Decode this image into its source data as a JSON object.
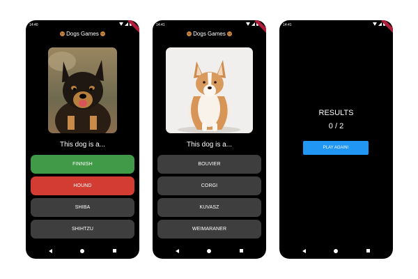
{
  "screens": [
    {
      "status_time": "14:40",
      "app_title": "Dogs Games",
      "question": "This dog is a...",
      "answers": [
        {
          "label": "FINNISH",
          "state": "correct"
        },
        {
          "label": "HOUND",
          "state": "wrong"
        },
        {
          "label": "SHIBA",
          "state": "default"
        },
        {
          "label": "SHIHTZU",
          "state": "default"
        }
      ],
      "photo": "black-and-tan finnish lapphund dog"
    },
    {
      "status_time": "14:41",
      "app_title": "Dogs Games",
      "question": "This dog is a...",
      "answers": [
        {
          "label": "BOUVIER",
          "state": "default"
        },
        {
          "label": "CORGI",
          "state": "default"
        },
        {
          "label": "KUVASZ",
          "state": "default"
        },
        {
          "label": "WEIMARANER",
          "state": "default"
        }
      ],
      "photo": "sitting corgi on white background"
    },
    {
      "status_time": "14:41",
      "results_title": "RESULTS",
      "score": "0 / 2",
      "play_again_label": "PLAY AGAIN!"
    }
  ],
  "colors": {
    "correct": "#419a47",
    "wrong": "#d23c33",
    "default_answer": "#3e3e3e",
    "primary": "#2196f3"
  }
}
